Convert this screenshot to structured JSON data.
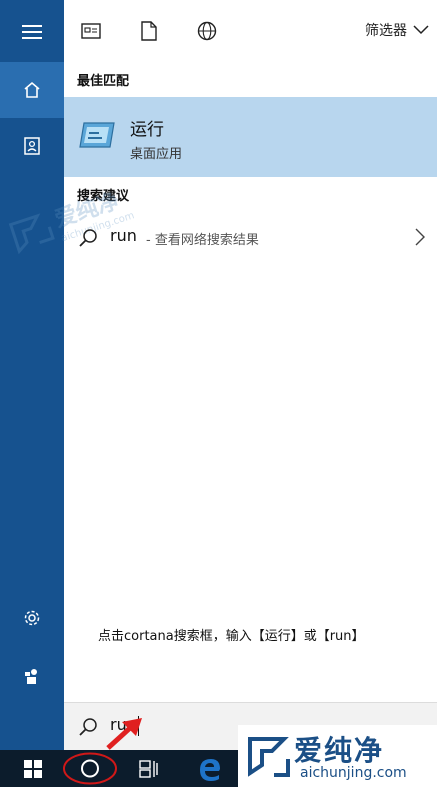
{
  "toolbar": {
    "filter_label": "筛选器"
  },
  "best_match": {
    "heading": "最佳匹配",
    "title": "运行",
    "subtitle": "桌面应用"
  },
  "suggestions": {
    "heading": "搜索建议",
    "query": "run",
    "description": "- 查看网络搜索结果"
  },
  "annotation": "点击cortana搜索框，输入【运行】或【run】",
  "search": {
    "value": "run"
  },
  "watermark": {
    "text": "爱纯净",
    "url": "aichunjing.com",
    "faint_text": "爱纯净",
    "faint_url": "aichunjing.com"
  },
  "colors": {
    "rail": "#16528f",
    "rail_active": "#2a6eb0",
    "best_bg": "#b8d6ee",
    "taskbar": "#0c1c2c",
    "annotation_arrow": "#e02020",
    "annotation_circle": "#d01818",
    "edge_blue": "#1e73c8"
  },
  "icons": [
    "hamburger-icon",
    "home-icon",
    "contact-icon",
    "settings-icon",
    "user-icon",
    "news-icon",
    "document-icon",
    "globe-icon",
    "chevron-down-icon",
    "run-app-icon",
    "search-icon",
    "chevron-right-icon",
    "windows-start-icon",
    "cortana-icon",
    "task-view-icon",
    "edge-icon"
  ]
}
